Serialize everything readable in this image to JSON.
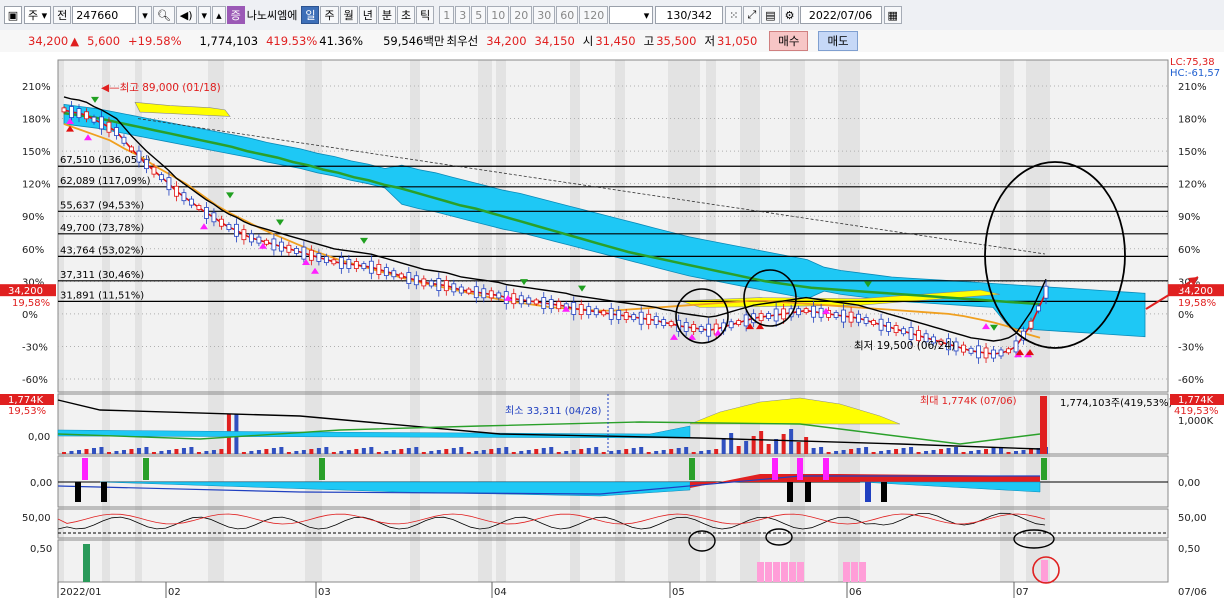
{
  "toolbar": {
    "period_label": "주",
    "prev_label": "전",
    "code": "247660",
    "badge": "증",
    "name": "나노씨엠에",
    "periods": [
      "일",
      "주",
      "월",
      "년",
      "분",
      "초",
      "틱"
    ],
    "active_period": "일",
    "nums": [
      "1",
      "3",
      "5",
      "10",
      "20",
      "30",
      "60",
      "120"
    ],
    "count": "130",
    "total": "/342",
    "date": "2022/07/06"
  },
  "quote": {
    "price": "34,200",
    "change": "5,600",
    "pct": "+19.58%",
    "volume": "1,774,103",
    "vol_pct": "419.53%",
    "turnover": "41.36%",
    "amount": "59,546백만",
    "best_label": "최우선",
    "best_ask": "34,200",
    "best_bid": "34,150",
    "open_label": "시",
    "open": "31,450",
    "high_label": "고",
    "high": "35,500",
    "low_label": "저",
    "low": "31,050",
    "buy_label": "매수",
    "sell_label": "매도"
  },
  "chart_data": {
    "type": "candlestick",
    "symbol": "247660",
    "y_axis_pct": [
      "210%",
      "180%",
      "150%",
      "120%",
      "90%",
      "60%",
      "30%",
      "0%",
      "-30%",
      "-60%"
    ],
    "y_axis_pct_values": [
      210,
      180,
      150,
      120,
      90,
      60,
      30,
      0,
      -30,
      -60
    ],
    "x_axis_labels": [
      "2022/01",
      "02",
      "03",
      "04",
      "05",
      "06",
      "07"
    ],
    "x_right_label": "07/06",
    "lc": "LC:75,38",
    "hc": "HC:-61,57",
    "right_price": "34,200",
    "right_pct": "19,58%",
    "left_price": "34,200",
    "left_pct": "19,58%",
    "levels": [
      {
        "label": "67,510 (136,05%)",
        "pct": 136.05
      },
      {
        "label": "62,089 (117,09%)",
        "pct": 117.09
      },
      {
        "label": "55,637 (94,53%)",
        "pct": 94.53
      },
      {
        "label": "49,700 (73,78%)",
        "pct": 73.78
      },
      {
        "label": "43,764 (53,02%)",
        "pct": 53.02
      },
      {
        "label": "37,311 (30,46%)",
        "pct": 30.46
      },
      {
        "label": "31,891 (11,51%)",
        "pct": 11.51
      }
    ],
    "annotations": {
      "high": "최고 89,000 (01/18)",
      "low": "최저 19,500 (06/24)",
      "vol_min": "최소 33,311 (04/28)",
      "vol_max": "최대 1,774K (07/06)",
      "vol_now": "1,774,103주(419,53%)"
    },
    "volume_axis": {
      "left_top": "1,774K",
      "left_pct": "19,53%",
      "left_zero": "0,00",
      "right_top": "1,774K",
      "right_pct": "419,53%",
      "right_mid": "1,000K"
    },
    "osc1_axis": {
      "left": "0,00",
      "right": "0,00"
    },
    "osc2_axis": {
      "left": "50,00",
      "right": "50,00"
    },
    "osc3_axis": {
      "left": "0,50",
      "right": "0,50"
    },
    "close_pct_series": [
      188,
      186,
      185,
      183,
      179,
      176,
      172,
      168,
      160,
      152,
      145,
      138,
      132,
      126,
      120,
      113,
      108,
      103,
      98,
      93,
      89,
      84,
      80,
      77,
      73,
      70,
      68,
      66,
      64,
      62,
      60,
      58,
      56,
      54,
      52,
      50,
      48,
      47,
      46,
      45,
      44,
      43,
      41,
      39,
      37,
      35,
      33,
      31,
      29,
      28,
      27,
      26,
      24,
      22,
      21,
      20,
      19,
      18,
      17,
      15,
      14,
      13,
      12,
      11,
      10,
      9,
      8,
      7,
      5,
      4,
      3,
      2,
      1,
      0,
      -1,
      -2,
      -3,
      -4,
      -5,
      -6,
      -8,
      -9,
      -11,
      -12,
      -13,
      -14,
      -15,
      -14,
      -12,
      -10,
      -8,
      -6,
      -4,
      -3,
      -2,
      -1,
      0,
      1,
      2,
      3,
      2,
      1,
      0,
      -1,
      -2,
      -3,
      -4,
      -6,
      -8,
      -10,
      -12,
      -14,
      -16,
      -18,
      -20,
      -22,
      -24,
      -26,
      -28,
      -30,
      -32,
      -34,
      -35,
      -36,
      -37,
      -36,
      -34,
      -30,
      -20,
      -10,
      5,
      20
    ],
    "ma_green_pct": [
      185,
      183,
      181,
      178,
      175,
      172,
      169,
      166,
      163,
      160,
      157,
      154,
      150,
      147,
      144,
      140,
      137,
      133,
      130,
      126,
      123,
      119,
      116,
      112,
      108,
      104,
      100,
      97,
      93,
      89,
      85,
      81,
      77,
      73,
      69,
      65,
      61,
      57,
      54,
      51,
      48,
      45,
      42,
      39,
      36,
      33,
      30,
      28,
      26,
      24,
      23,
      22,
      21,
      20,
      19,
      18,
      17,
      16,
      15,
      14,
      13,
      12,
      11,
      10,
      9
    ],
    "ma_orange_pct": [
      175,
      170,
      165,
      160,
      152,
      145,
      136,
      128,
      120,
      110,
      100,
      92,
      85,
      78,
      72,
      66,
      60,
      55,
      50,
      46,
      42,
      38,
      34,
      30,
      27,
      24,
      21,
      18,
      15,
      12,
      10,
      8,
      6,
      5,
      4,
      3,
      3,
      4,
      5,
      6,
      7,
      8,
      9,
      10,
      11,
      12,
      12,
      11,
      10,
      9,
      8,
      7,
      6,
      5,
      4,
      3,
      2,
      1,
      0,
      -2,
      -5,
      -8,
      -12,
      -18,
      -22
    ]
  }
}
